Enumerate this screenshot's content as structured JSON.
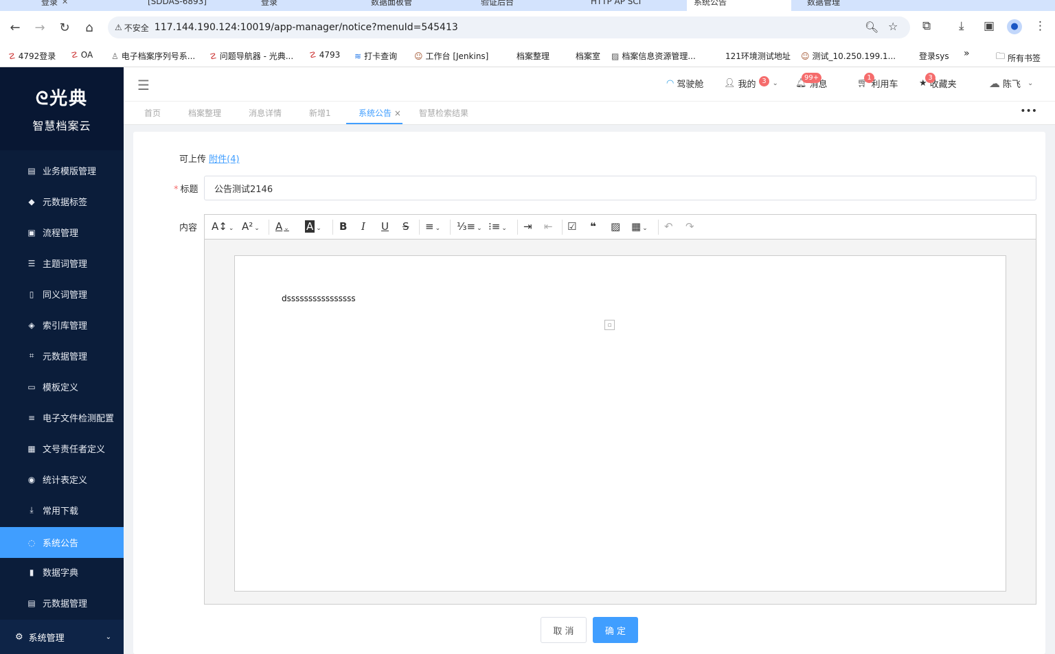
{
  "browser": {
    "tabs": [
      "登录",
      "[SDDAS-6893]",
      "登录",
      "数据面板管",
      "验证后台",
      "HTTP AP SCI",
      "系统公告",
      "数据管理"
    ],
    "url_warning": "不安全",
    "url": "117.144.190.124:10019/app-manager/notice?menuId=545413",
    "bookmarks": [
      "4792登录",
      "OA",
      "电子档案序列号系...",
      "问题导航器 - 光典...",
      "4793",
      "打卡查询",
      "工作台 [Jenkins]",
      "档案整理",
      "档案室",
      "档案信息资源管理...",
      "121环境测试地址",
      "测试_10.250.199.1...",
      "登录sys",
      "所有书签"
    ],
    "more_bookmarks": "»"
  },
  "app": {
    "logo_text": "光典",
    "logo_subtitle": "智慧档案云",
    "menu": [
      {
        "label": "业务模版管理",
        "icon": "template-icon"
      },
      {
        "label": "元数据标签",
        "icon": "tag-icon"
      },
      {
        "label": "流程管理",
        "icon": "flow-icon"
      },
      {
        "label": "主题词管理",
        "icon": "list-icon"
      },
      {
        "label": "同义词管理",
        "icon": "file-icon"
      },
      {
        "label": "索引库管理",
        "icon": "layers-icon"
      },
      {
        "label": "元数据管理",
        "icon": "crop-icon"
      },
      {
        "label": "模板定义",
        "icon": "box-icon"
      },
      {
        "label": "电子文件检测配置",
        "icon": "sliders-icon"
      },
      {
        "label": "文号责任者定义",
        "icon": "grid-icon"
      },
      {
        "label": "统计表定义",
        "icon": "toggle-icon"
      },
      {
        "label": "常用下载",
        "icon": "download-icon"
      },
      {
        "label": "系统公告",
        "icon": "chat-icon"
      },
      {
        "label": "数据字典",
        "icon": "book-icon"
      },
      {
        "label": "元数据管理",
        "icon": "table-icon"
      }
    ],
    "system_management": "系统管理",
    "header": {
      "cockpit": "驾驶舱",
      "mine": "我的",
      "mine_badge": "3",
      "messages": "消息",
      "messages_badge": "99+",
      "cart": "利用车",
      "cart_badge": "1",
      "favorites": "收藏夹",
      "favorites_badge": "3",
      "user": "陈飞"
    },
    "tabs": [
      "首页",
      "档案整理",
      "消息详情",
      "新增1",
      "系统公告",
      "智慧检索结果"
    ],
    "active_tab_close": "×"
  },
  "form": {
    "upload_label": "可上传",
    "attachment_link": "附件(4)",
    "title_label": "标题",
    "title_value": "公告测试2146",
    "content_label": "内容",
    "editor_text": "dssssssssssssssss",
    "cancel_button": "取 消",
    "ok_button": "确 定"
  },
  "colors": {
    "accent": "#409eff",
    "sidebar": "#0b1d3a",
    "badge": "#f56c6c"
  }
}
